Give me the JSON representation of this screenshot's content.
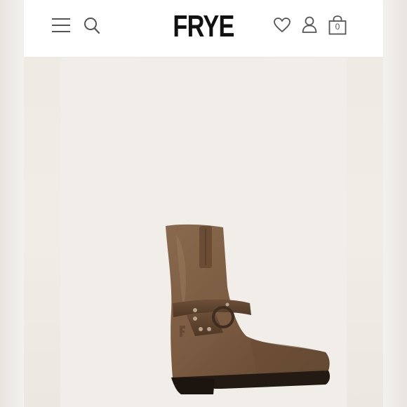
{
  "header": {
    "brand": "FRYE",
    "icons": {
      "menu": "hamburger-menu-icon",
      "search": "search-icon",
      "wishlist": "heart-icon",
      "account": "user-icon",
      "cart": "shopping-bag-icon"
    },
    "cart_count": "0"
  },
  "product": {
    "image": "brown-harness-boot-image"
  },
  "colors": {
    "header_bg": "#ffffff",
    "page_bg": "#f1eee9",
    "icon": "#4a4a4a",
    "brand": "#111111",
    "boot_leather": "#7a5a40"
  }
}
